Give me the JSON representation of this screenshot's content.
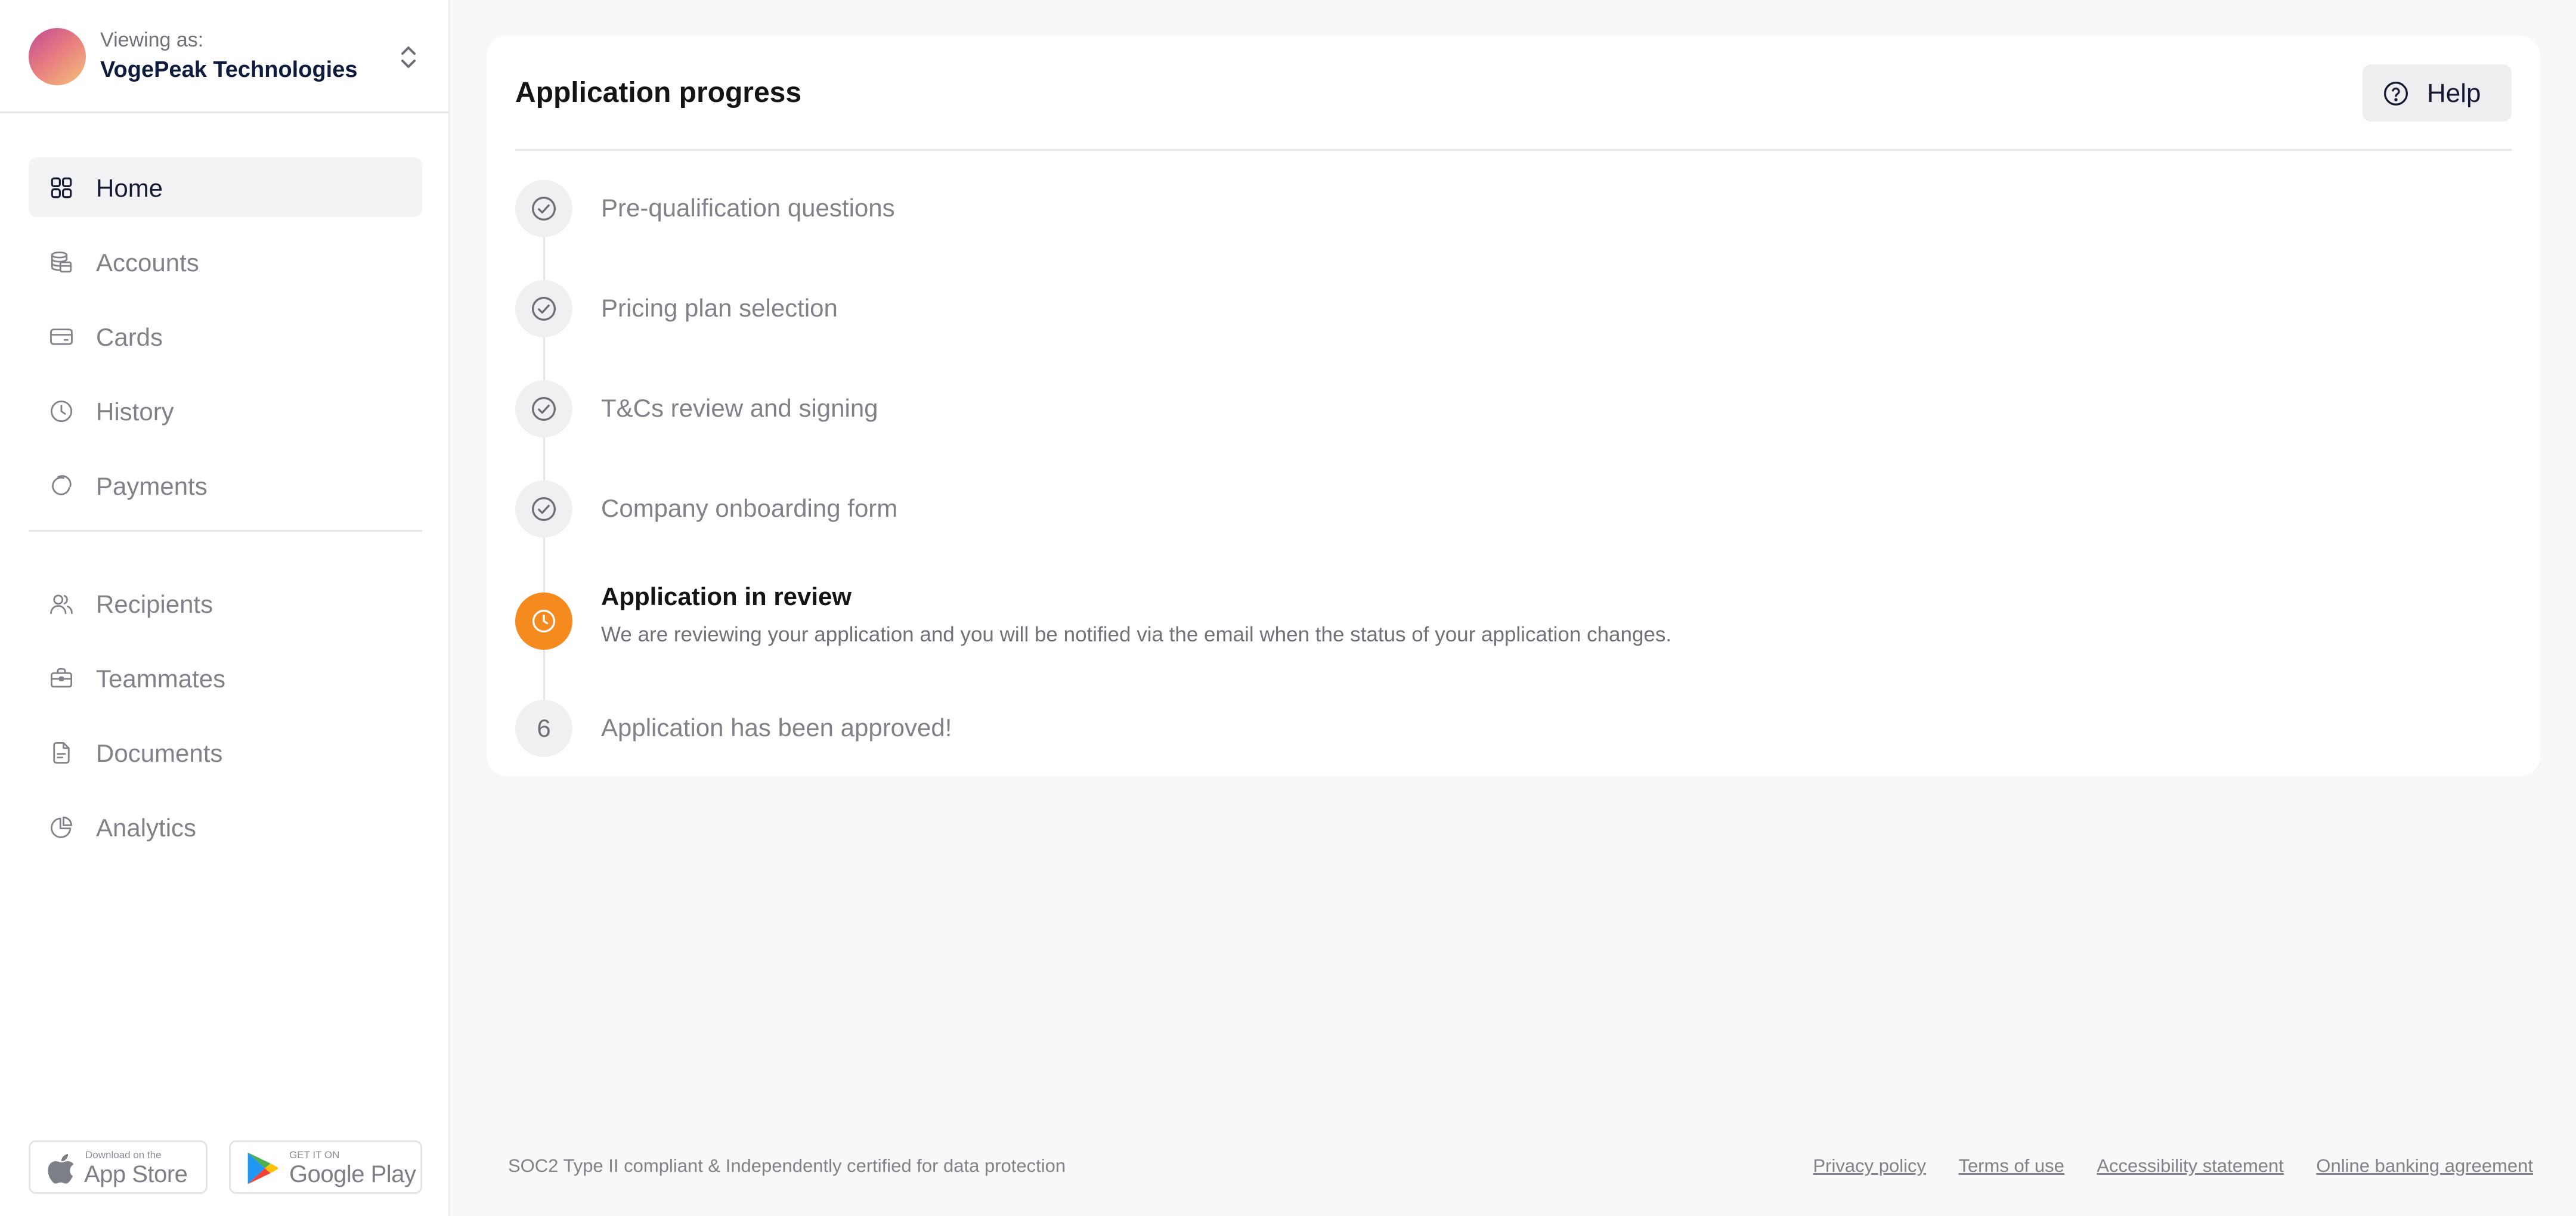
{
  "account": {
    "viewing_label": "Viewing as:",
    "company_name": "VogePeak Technologies",
    "switch_icon": "chevron-up-down-icon"
  },
  "sidebar": {
    "primary_items": [
      {
        "label": "Home",
        "icon": "grid-icon",
        "active": true
      },
      {
        "label": "Accounts",
        "icon": "coin-stack-icon",
        "active": false
      },
      {
        "label": "Cards",
        "icon": "credit-card-icon",
        "active": false
      },
      {
        "label": "History",
        "icon": "clock-icon",
        "active": false
      },
      {
        "label": "Payments",
        "icon": "payments-icon",
        "active": false
      }
    ],
    "secondary_items": [
      {
        "label": "Recipients",
        "icon": "users-icon"
      },
      {
        "label": "Teammates",
        "icon": "briefcase-icon"
      },
      {
        "label": "Documents",
        "icon": "document-icon"
      },
      {
        "label": "Analytics",
        "icon": "pie-chart-icon"
      }
    ],
    "app_store": {
      "small": "Download on the",
      "big": "App Store",
      "icon": "apple-icon"
    },
    "google_play": {
      "small": "GET IT ON",
      "big": "Google Play",
      "icon": "google-play-icon"
    }
  },
  "main": {
    "title": "Application progress",
    "help_label": "Help",
    "help_icon": "question-circle-icon",
    "steps": [
      {
        "label": "Pre-qualification questions",
        "status": "completed",
        "icon": "check-circle-icon"
      },
      {
        "label": "Pricing plan selection",
        "status": "completed",
        "icon": "check-circle-icon"
      },
      {
        "label": "T&Cs review and signing",
        "status": "completed",
        "icon": "check-circle-icon"
      },
      {
        "label": "Company onboarding form",
        "status": "completed",
        "icon": "check-circle-icon"
      },
      {
        "label": "Application in review",
        "status": "current",
        "icon": "clock-icon",
        "description": "We are reviewing your application and you will be notified via the email when the status of your application changes."
      },
      {
        "label": "Application has been approved!",
        "status": "upcoming",
        "number": "6"
      }
    ]
  },
  "footer": {
    "note": "SOC2 Type II compliant & Independently certified for data protection",
    "links": [
      "Privacy policy",
      "Terms of use",
      "Accessibility statement",
      "Online banking agreement"
    ]
  },
  "colors": {
    "accent": "#f58a1f",
    "text_primary": "#141414",
    "text_muted": "#80828a",
    "background": "#f8f8f8"
  }
}
